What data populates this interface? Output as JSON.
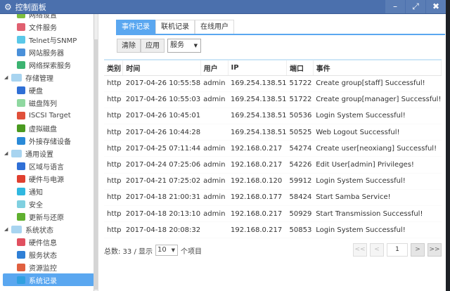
{
  "window": {
    "title": "控制面板",
    "minimize_icon": "minimize-icon",
    "maximize_icon": "maximize-icon",
    "close_icon": "close-icon"
  },
  "sidebar": [
    {
      "label": "网络设置",
      "type": "child",
      "color": "#7fbf3f"
    },
    {
      "label": "文件服务",
      "type": "child",
      "color": "#e06070"
    },
    {
      "label": "Telnet与SNMP",
      "type": "child",
      "color": "#5ac8e8"
    },
    {
      "label": "网站服务器",
      "type": "child",
      "color": "#4a90d9"
    },
    {
      "label": "网络探索服务",
      "type": "child",
      "color": "#3cb371"
    },
    {
      "label": "存储管理",
      "type": "group"
    },
    {
      "label": "硬盘",
      "type": "child",
      "color": "#2f6fd6"
    },
    {
      "label": "磁盘阵列",
      "type": "child",
      "color": "#8fd8a0"
    },
    {
      "label": "ISCSI Target",
      "type": "child",
      "color": "#e0503a"
    },
    {
      "label": "虚拟磁盘",
      "type": "child",
      "color": "#4a9a20"
    },
    {
      "label": "外接存储设备",
      "type": "child",
      "color": "#2a8ad8"
    },
    {
      "label": "通用设置",
      "type": "group"
    },
    {
      "label": "区域与语言",
      "type": "child",
      "color": "#2f6fd6"
    },
    {
      "label": "硬件与电源",
      "type": "child",
      "color": "#e04030"
    },
    {
      "label": "通知",
      "type": "child",
      "color": "#30b8e0"
    },
    {
      "label": "安全",
      "type": "child",
      "color": "#80d0e0"
    },
    {
      "label": "更新与还原",
      "type": "child",
      "color": "#60b030"
    },
    {
      "label": "系统状态",
      "type": "group"
    },
    {
      "label": "硬件信息",
      "type": "child",
      "color": "#e05060"
    },
    {
      "label": "服务状态",
      "type": "child",
      "color": "#2f7fd6"
    },
    {
      "label": "资源监控",
      "type": "child",
      "color": "#e06040"
    },
    {
      "label": "系统记录",
      "type": "child",
      "color": "#30a0e0",
      "selected": true
    }
  ],
  "tabs": [
    "事件记录",
    "联机记录",
    "在线用户"
  ],
  "toolbar": {
    "clear": "清除",
    "apply": "应用",
    "filter": "服务"
  },
  "table": {
    "headers": [
      "类别",
      "时间",
      "用户",
      "IP",
      "端口",
      "事件"
    ],
    "rows": [
      [
        "http",
        "2017-04-26 10:55:58",
        "admin",
        "169.254.138.51",
        "51722",
        "Create group[staff] Successful!"
      ],
      [
        "http",
        "2017-04-26 10:55:03",
        "admin",
        "169.254.138.51",
        "51722",
        "Create group[manager] Successful!"
      ],
      [
        "http",
        "2017-04-26 10:45:01",
        "",
        "169.254.138.51",
        "50536",
        "Login System Successful!"
      ],
      [
        "http",
        "2017-04-26 10:44:28",
        "",
        "169.254.138.51",
        "50525",
        "Web Logout Successful!"
      ],
      [
        "http",
        "2017-04-25 07:11:44",
        "admin",
        "192.168.0.217",
        "54274",
        "Create user[neoxiang] Successful!"
      ],
      [
        "http",
        "2017-04-24 07:25:06",
        "admin",
        "192.168.0.217",
        "54226",
        "Edit User[admin] Privileges!"
      ],
      [
        "http",
        "2017-04-21 07:25:02",
        "admin",
        "192.168.0.120",
        "59912",
        "Login System Successful!"
      ],
      [
        "http",
        "2017-04-18 21:00:31",
        "admin",
        "192.168.0.177",
        "58424",
        "Start Samba Service!"
      ],
      [
        "http",
        "2017-04-18 20:13:10",
        "admin",
        "192.168.0.217",
        "50929",
        "Start Transmission Successful!"
      ],
      [
        "http",
        "2017-04-18 20:08:32",
        "",
        "192.168.0.217",
        "50853",
        "Login System Successful!"
      ]
    ]
  },
  "footer": {
    "total": "总数: 33 / 显示",
    "page_size": "10",
    "suffix": "个项目"
  },
  "pager": {
    "first": "<<",
    "prev": "<",
    "page": "1",
    "next": ">",
    "last": ">>"
  }
}
